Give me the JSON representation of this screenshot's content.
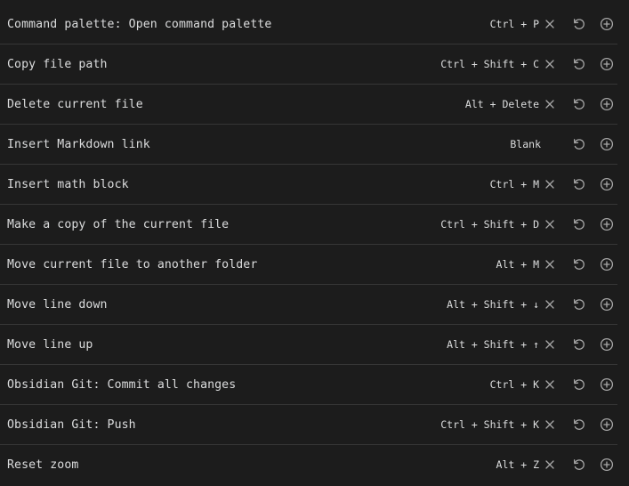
{
  "commands": [
    {
      "name": "Command palette: Open command palette",
      "hotkey": "Ctrl + P",
      "removable": true
    },
    {
      "name": "Copy file path",
      "hotkey": "Ctrl + Shift + C",
      "removable": true
    },
    {
      "name": "Delete current file",
      "hotkey": "Alt + Delete",
      "removable": true
    },
    {
      "name": "Insert Markdown link",
      "hotkey": "Blank",
      "removable": false
    },
    {
      "name": "Insert math block",
      "hotkey": "Ctrl + M",
      "removable": true
    },
    {
      "name": "Make a copy of the current file",
      "hotkey": "Ctrl + Shift + D",
      "removable": true
    },
    {
      "name": "Move current file to another folder",
      "hotkey": "Alt + M",
      "removable": true
    },
    {
      "name": "Move line down",
      "hotkey": "Alt + Shift + ↓",
      "removable": true
    },
    {
      "name": "Move line up",
      "hotkey": "Alt + Shift + ↑",
      "removable": true
    },
    {
      "name": "Obsidian Git: Commit all changes",
      "hotkey": "Ctrl + K",
      "removable": true
    },
    {
      "name": "Obsidian Git: Push",
      "hotkey": "Ctrl + Shift + K",
      "removable": true
    },
    {
      "name": "Reset zoom",
      "hotkey": "Alt + Z",
      "removable": true
    }
  ],
  "icons": {
    "remove": "close-icon",
    "restore": "reset-icon",
    "add": "plus-circle-icon"
  },
  "colors": {
    "background": "#1c1c1c",
    "text": "#dcddde",
    "divider": "#363636",
    "icon": "#a8a8a8"
  }
}
